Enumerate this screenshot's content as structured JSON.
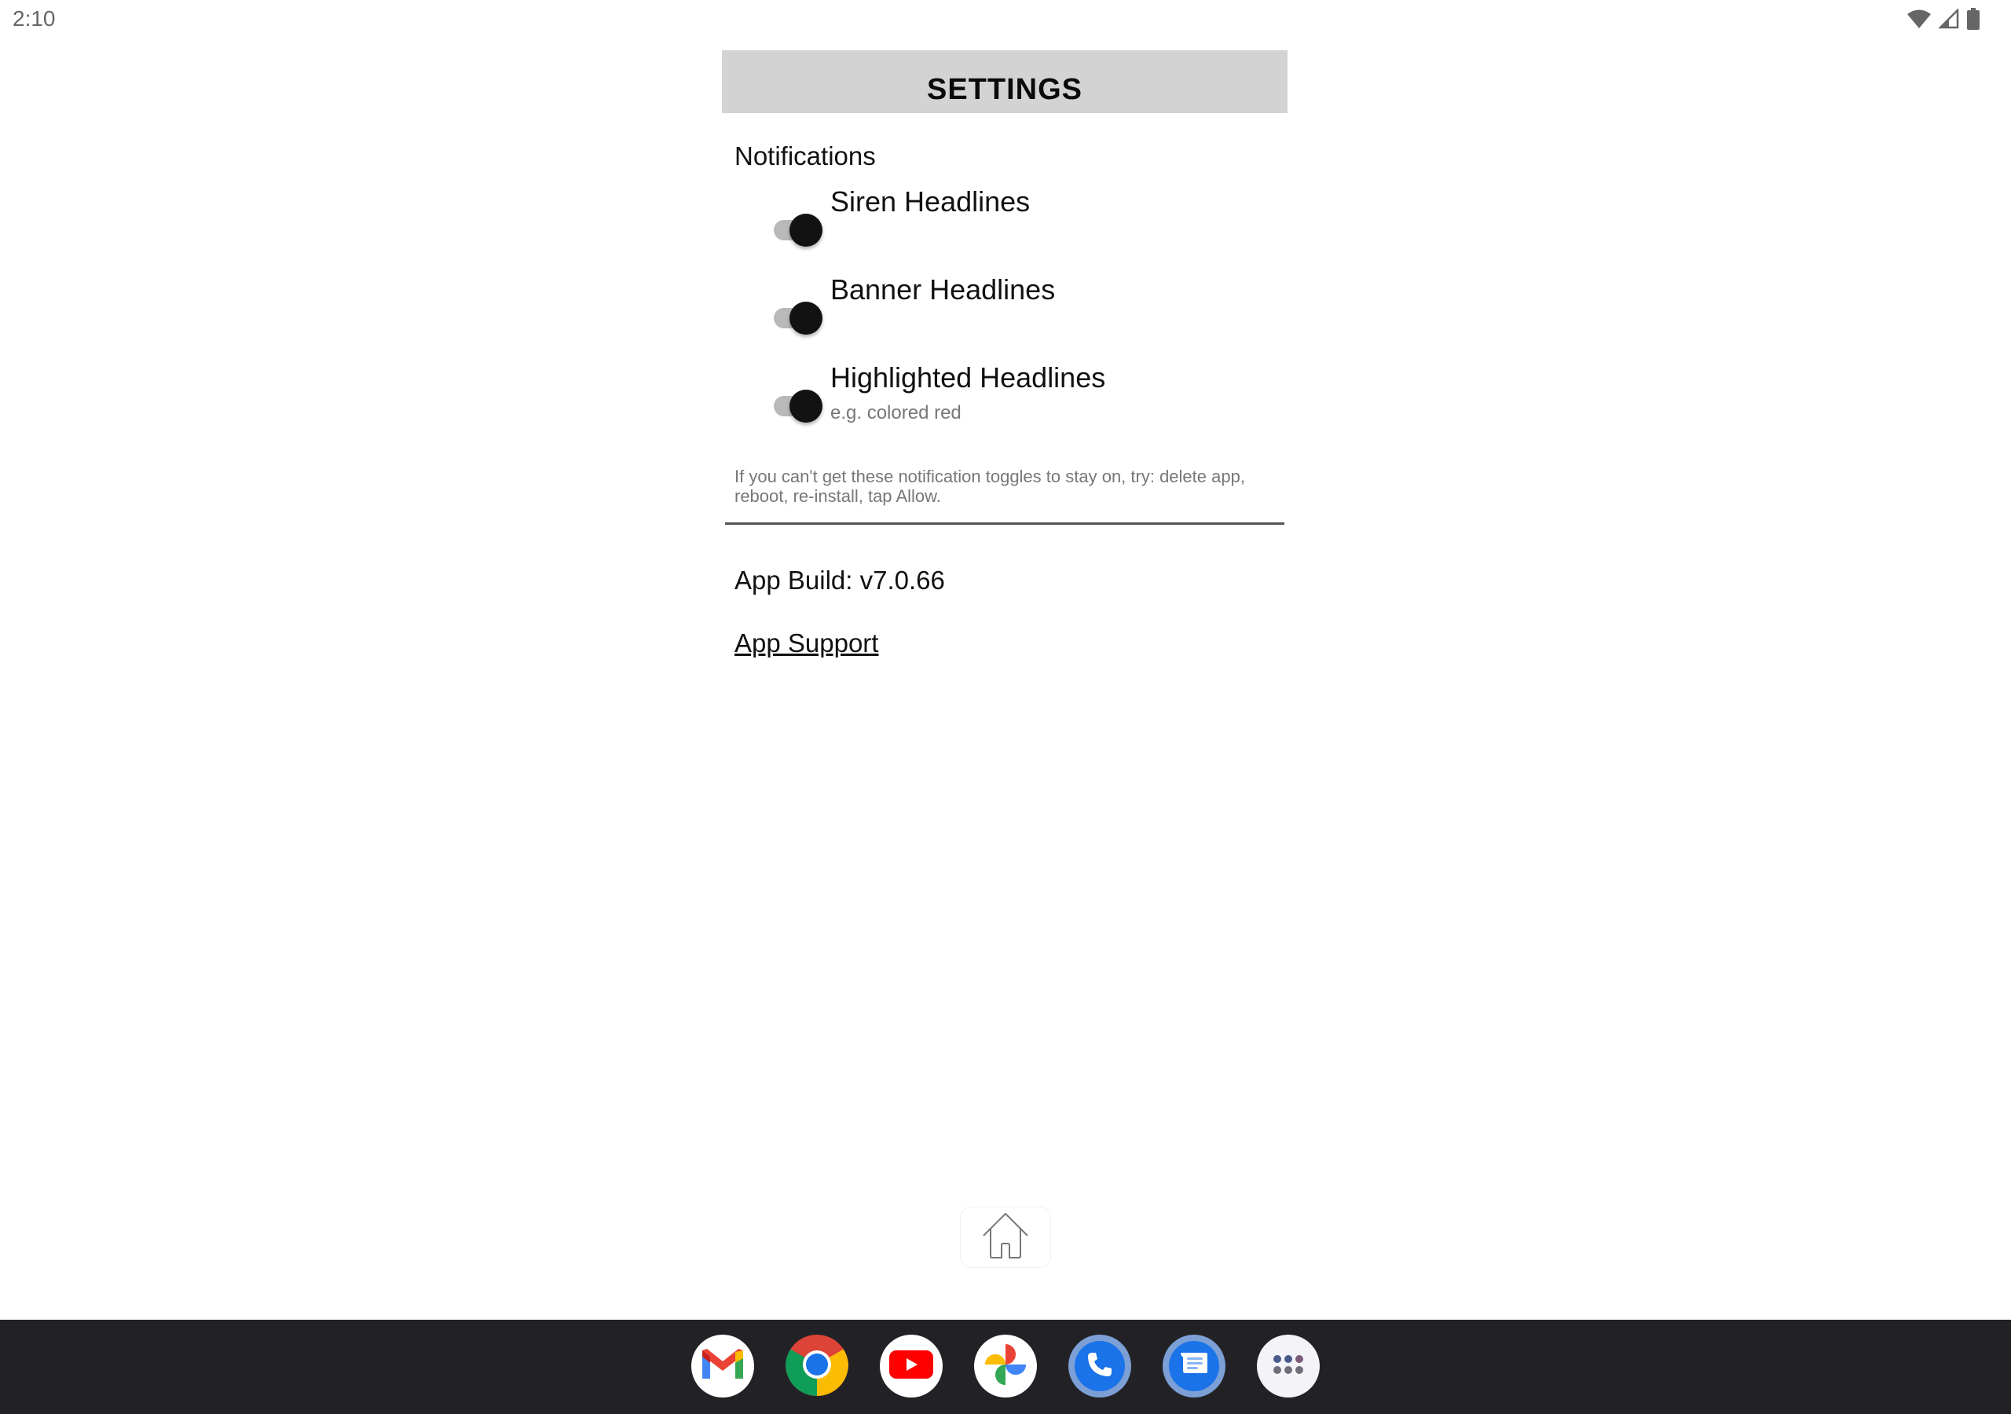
{
  "status_bar": {
    "time": "2:10",
    "icons": [
      "wifi-icon",
      "cellular-signal-icon",
      "battery-icon"
    ]
  },
  "header": {
    "title": "SETTINGS",
    "background_color": "#d3d3d3"
  },
  "notifications": {
    "section_title": "Notifications",
    "toggles": [
      {
        "label": "Siren Headlines",
        "subtitle": "",
        "state": "on"
      },
      {
        "label": "Banner Headlines",
        "subtitle": "",
        "state": "on"
      },
      {
        "label": "Highlighted Headlines",
        "subtitle": "e.g. colored red",
        "state": "on"
      }
    ],
    "help_text": "If you can't get these notification toggles to stay on, try: delete app, reboot, re-install, tap Allow."
  },
  "app_info": {
    "build_label": "App Build: v7.0.66",
    "support_link": "App Support"
  },
  "navigation": {
    "home_icon": "home-icon"
  },
  "dock": {
    "apps": [
      {
        "name": "Gmail",
        "icon": "gmail-icon"
      },
      {
        "name": "Chrome",
        "icon": "chrome-icon"
      },
      {
        "name": "YouTube",
        "icon": "youtube-icon"
      },
      {
        "name": "Photos",
        "icon": "photos-icon"
      },
      {
        "name": "Phone",
        "icon": "phone-icon"
      },
      {
        "name": "Messages",
        "icon": "messages-icon"
      },
      {
        "name": "App Drawer",
        "icon": "app-drawer-icon"
      }
    ],
    "background_color": "#222226"
  }
}
